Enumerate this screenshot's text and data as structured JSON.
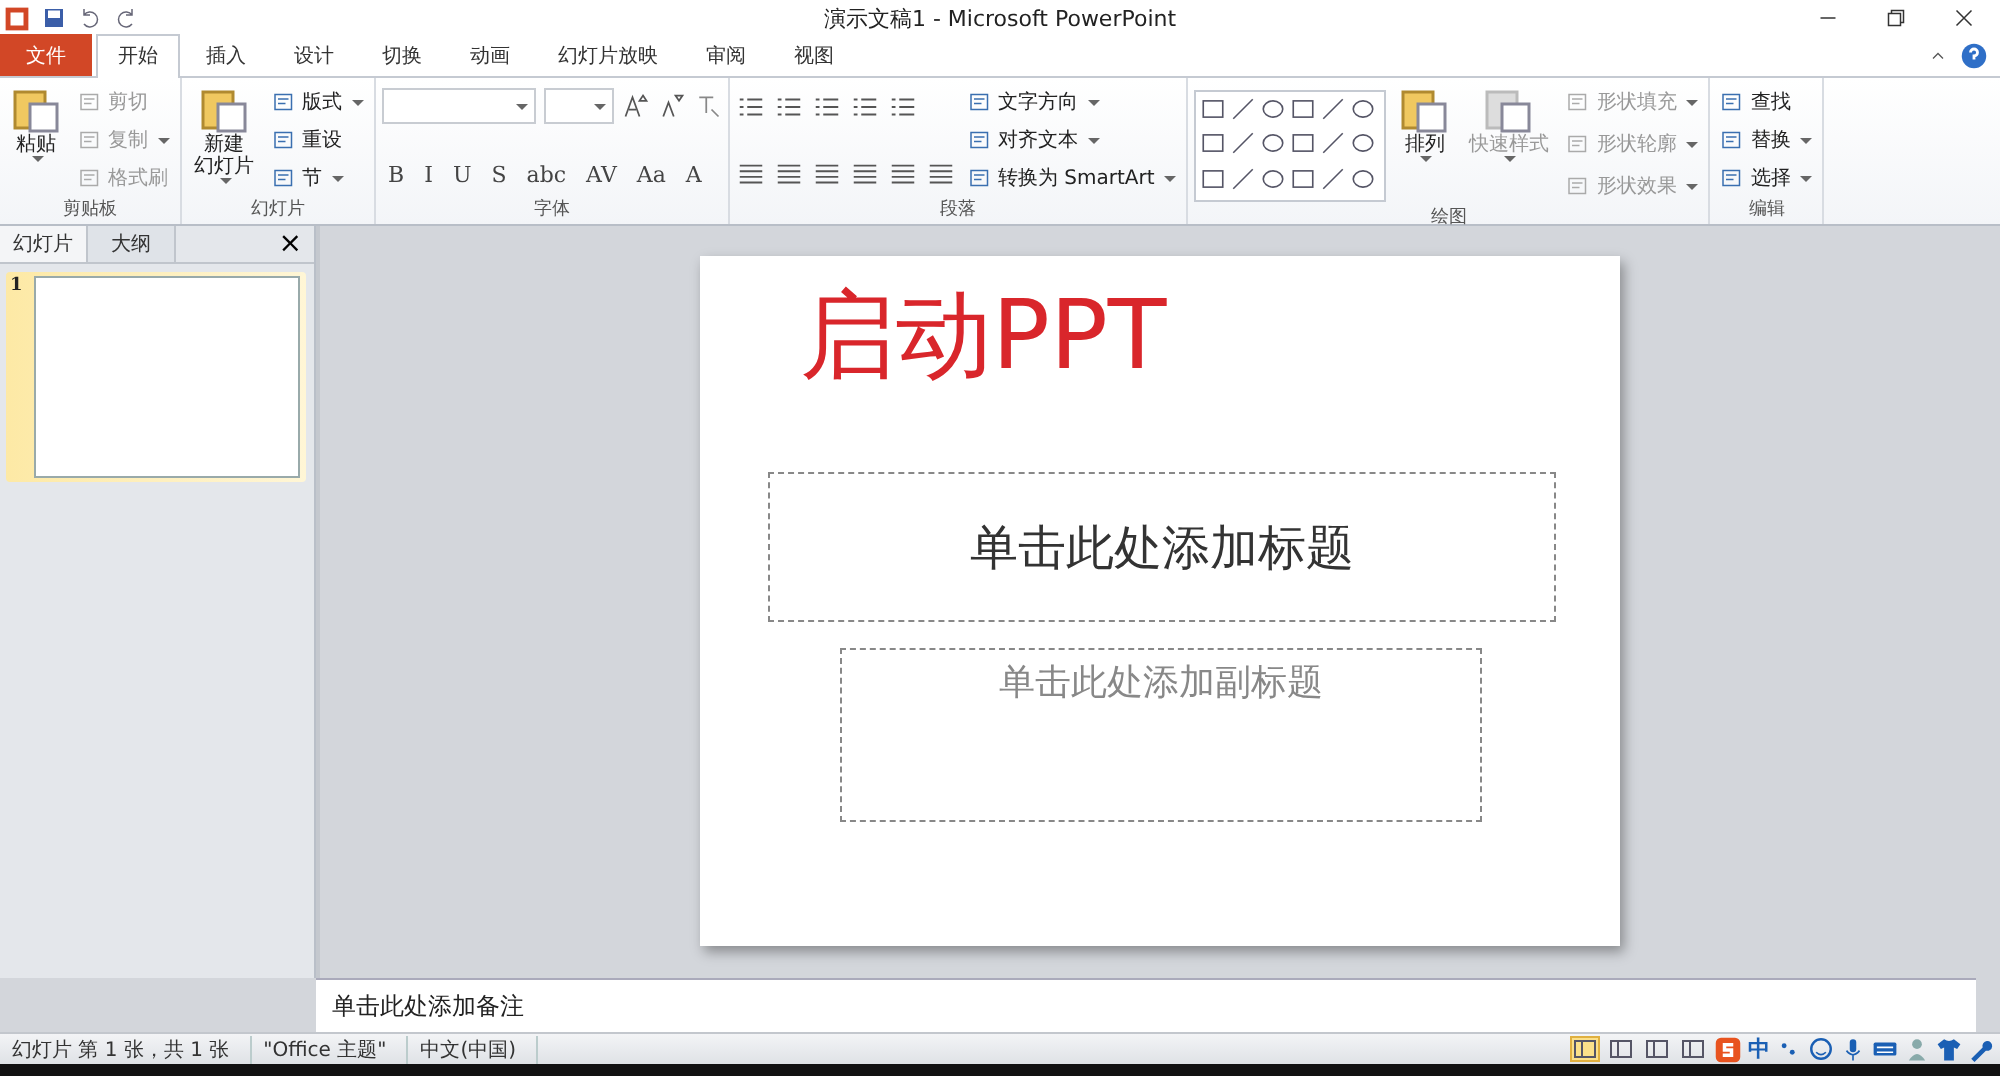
{
  "window": {
    "title": "演示文稿1 - Microsoft PowerPoint"
  },
  "tabs": [
    {
      "label": "文件",
      "kind": "file",
      "selected": false
    },
    {
      "label": "开始",
      "kind": "tab",
      "selected": true
    },
    {
      "label": "插入",
      "kind": "tab",
      "selected": false
    },
    {
      "label": "设计",
      "kind": "tab",
      "selected": false
    },
    {
      "label": "切换",
      "kind": "tab",
      "selected": false
    },
    {
      "label": "动画",
      "kind": "tab",
      "selected": false
    },
    {
      "label": "幻灯片放映",
      "kind": "tab",
      "selected": false
    },
    {
      "label": "审阅",
      "kind": "tab",
      "selected": false
    },
    {
      "label": "视图",
      "kind": "tab",
      "selected": false
    }
  ],
  "ribbon": [
    {
      "label": "剪贴板",
      "columns": [
        [
          {
            "kind": "large",
            "label": "粘贴",
            "disabled": false,
            "dropdown": true
          }
        ],
        [
          {
            "kind": "small",
            "label": "剪切",
            "disabled": true,
            "dropdown": false
          },
          {
            "kind": "small",
            "label": "复制",
            "disabled": true,
            "dropdown": true
          },
          {
            "kind": "small",
            "label": "格式刷",
            "disabled": true,
            "dropdown": false
          }
        ]
      ]
    },
    {
      "label": "幻灯片",
      "columns": [
        [
          {
            "kind": "large",
            "lines": [
              "新建",
              "幻灯片"
            ],
            "disabled": false,
            "dropdown": true
          }
        ],
        [
          {
            "kind": "small",
            "label": "版式",
            "disabled": false,
            "dropdown": true
          },
          {
            "kind": "small",
            "label": "重设",
            "disabled": false,
            "dropdown": false
          },
          {
            "kind": "small",
            "label": "节",
            "disabled": false,
            "dropdown": true
          }
        ]
      ]
    },
    {
      "label": "字体",
      "columns": [
        [
          {
            "kind": "fontrow"
          },
          {
            "kind": "glyphs",
            "glyphs": [
              "B",
              "I",
              "U",
              "S",
              "abc",
              "AV",
              "Aa",
              "A"
            ]
          }
        ]
      ]
    },
    {
      "label": "段落",
      "columns": [
        [
          {
            "kind": "pararow"
          },
          {
            "kind": "pararow2"
          }
        ],
        [
          {
            "kind": "small",
            "label": "文字方向",
            "disabled": false,
            "dropdown": true
          },
          {
            "kind": "small",
            "label": "对齐文本",
            "disabled": false,
            "dropdown": true
          },
          {
            "kind": "small",
            "label": "转换为 SmartArt",
            "disabled": false,
            "dropdown": true
          }
        ]
      ]
    },
    {
      "label": "绘图",
      "columns": [
        [
          {
            "kind": "gallery"
          }
        ],
        [
          {
            "kind": "large",
            "label": "排列",
            "disabled": false,
            "dropdown": true
          }
        ],
        [
          {
            "kind": "large",
            "label": "快速样式",
            "disabled": true,
            "dropdown": true
          }
        ],
        [
          {
            "kind": "small",
            "label": "形状填充",
            "disabled": true,
            "dropdown": true
          },
          {
            "kind": "small",
            "label": "形状轮廓",
            "disabled": true,
            "dropdown": true
          },
          {
            "kind": "small",
            "label": "形状效果",
            "disabled": true,
            "dropdown": true
          }
        ]
      ]
    },
    {
      "label": "编辑",
      "columns": [
        [
          {
            "kind": "small",
            "label": "查找",
            "disabled": false,
            "dropdown": false
          },
          {
            "kind": "small",
            "label": "替换",
            "disabled": false,
            "dropdown": true
          },
          {
            "kind": "small",
            "label": "选择",
            "disabled": false,
            "dropdown": true
          }
        ]
      ]
    }
  ],
  "pane_tabs": [
    {
      "label": "幻灯片",
      "selected": true
    },
    {
      "label": "大纲",
      "selected": false
    }
  ],
  "pane_close": "×",
  "thumbnails": [
    {
      "number": "1",
      "selected": true
    }
  ],
  "slide": {
    "annotation": "启动PPT",
    "title_placeholder": "单击此处添加标题",
    "subtitle_placeholder": "单击此处添加副标题"
  },
  "notes": {
    "placeholder": "单击此处添加备注"
  },
  "status_bar": {
    "items": [
      "幻灯片 第 1 张，共 1 张",
      "\"Office 主题\"",
      "中文(中国)"
    ],
    "views": [
      {
        "selected": true
      },
      {
        "selected": false
      },
      {
        "selected": false
      },
      {
        "selected": false
      }
    ],
    "ime_label": "中"
  }
}
